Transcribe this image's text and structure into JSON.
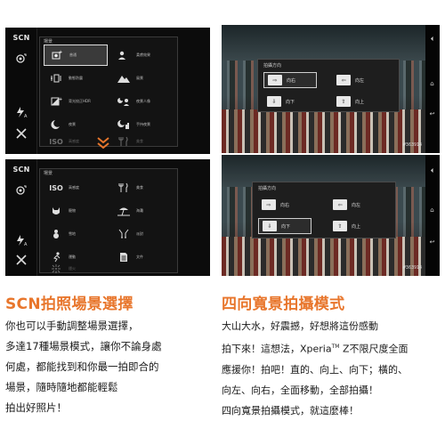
{
  "scene_panel_top": {
    "side_label": "SCN",
    "grid_title": "場景",
    "items": [
      {
        "label": "普通",
        "icon": "scene-auto-icon",
        "selected": true
      },
      {
        "label": "柔膚效果",
        "icon": "soft-skin-icon",
        "selected": false
      },
      {
        "label": "動態防震",
        "icon": "anti-motion-blur-icon",
        "selected": false
      },
      {
        "label": "風景",
        "icon": "landscape-icon",
        "selected": false
      },
      {
        "label": "背光校正HDR",
        "icon": "backlight-hdr-icon",
        "selected": false
      },
      {
        "label": "夜景人像",
        "icon": "night-portrait-icon",
        "selected": false
      },
      {
        "label": "夜景",
        "icon": "night-scene-icon",
        "selected": false
      },
      {
        "label": "手持夜景",
        "icon": "handheld-twilight-icon",
        "selected": false
      },
      {
        "label": "高感度",
        "icon": "high-sensitivity-icon",
        "selected": false,
        "dim": true
      },
      {
        "label": "美食",
        "icon": "gourmet-icon",
        "selected": false,
        "dim": true
      }
    ]
  },
  "scene_panel_bottom": {
    "side_label": "SCN",
    "grid_title": "場景",
    "items": [
      {
        "label": "高感度",
        "icon": "high-sensitivity-icon",
        "selected": false
      },
      {
        "label": "美食",
        "icon": "gourmet-icon",
        "selected": false
      },
      {
        "label": "寵物",
        "icon": "pet-icon",
        "selected": false
      },
      {
        "label": "海灘",
        "icon": "beach-icon",
        "selected": false
      },
      {
        "label": "雪地",
        "icon": "snow-icon",
        "selected": false
      },
      {
        "label": "派對",
        "icon": "party-icon",
        "selected": false
      },
      {
        "label": "運動",
        "icon": "sports-icon",
        "selected": false
      },
      {
        "label": "文件",
        "icon": "document-icon",
        "selected": false
      },
      {
        "label": "煙火",
        "icon": "fireworks-icon",
        "selected": false,
        "dim": true
      }
    ]
  },
  "sweep_panel_top": {
    "dialog_title": "拍攝方向",
    "options": [
      {
        "label": "向右",
        "glyph": "⇨",
        "selected": true
      },
      {
        "label": "向左",
        "glyph": "⇦",
        "selected": false
      },
      {
        "label": "向下",
        "glyph": "⇩",
        "selected": false
      },
      {
        "label": "向上",
        "glyph": "⇧",
        "selected": false
      }
    ],
    "counter": "#363914"
  },
  "sweep_panel_bottom": {
    "dialog_title": "拍攝方向",
    "options": [
      {
        "label": "向右",
        "glyph": "⇨",
        "selected": false
      },
      {
        "label": "向左",
        "glyph": "⇦",
        "selected": false
      },
      {
        "label": "向下",
        "glyph": "⇩",
        "selected": true
      },
      {
        "label": "向上",
        "glyph": "⇧",
        "selected": false
      }
    ],
    "counter": "#363914"
  },
  "left_section": {
    "heading": "SCN拍照場景選擇",
    "lines": [
      "你也可以手動調整場景選擇，",
      "多達17種場景模式，讓你不論身處",
      "何處，都能找到和你最一拍即合的",
      "場景，隨時隨地都能輕鬆",
      "拍出好照片！"
    ]
  },
  "right_section": {
    "heading": "四向寬景拍攝模式",
    "lines": [
      "大山大水，好震撼，好想將這份感動",
      "拍下來！這想法，Xperia",
      "應援你！拍吧！直的、向上、向下；橫的、",
      "向左、向右，全面移動，全部拍攝！",
      "四向寬景拍攝模式，就這麼棒！"
    ],
    "tm": "TM",
    "line2_tail": " Z不限尺度全面"
  },
  "colors": {
    "accent": "#e8762c",
    "text": "#1a1a1a",
    "panel_bg": "#0c0c0c"
  }
}
